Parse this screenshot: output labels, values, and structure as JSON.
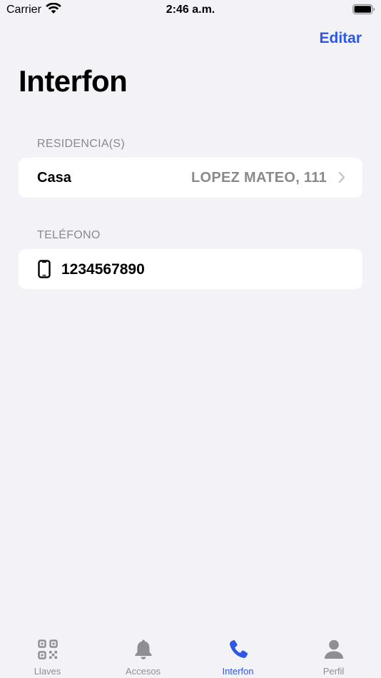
{
  "status": {
    "carrier": "Carrier",
    "time": "2:46 a.m."
  },
  "nav": {
    "edit_label": "Editar",
    "title": "Interfon"
  },
  "residencias": {
    "header": "RESIDENCIA(S)",
    "items": [
      {
        "label": "Casa",
        "value": "LOPEZ MATEO, 111"
      }
    ]
  },
  "telefono": {
    "header": "TELÉFONO",
    "number": "1234567890"
  },
  "tabs": [
    {
      "label": "Llaves",
      "icon": "qr-code-icon",
      "active": false
    },
    {
      "label": "Accesos",
      "icon": "bell-icon",
      "active": false
    },
    {
      "label": "Interfon",
      "icon": "phone-icon",
      "active": true
    },
    {
      "label": "Perfil",
      "icon": "person-icon",
      "active": false
    }
  ],
  "colors": {
    "accent": "#2e57e6",
    "background": "#f2f2f7",
    "secondary_text": "#8a8a8e"
  }
}
